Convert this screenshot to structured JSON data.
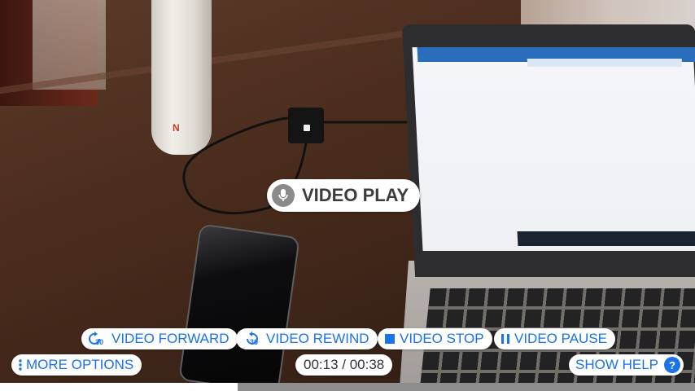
{
  "overlay": {
    "play_label": "VIDEO PLAY",
    "forward_label": "VIDEO FORWARD",
    "rewind_label": "VIDEO REWIND",
    "stop_label": "VIDEO STOP",
    "pause_label": "VIDEO PAUSE",
    "more_label": "MORE OPTIONS",
    "time_label": "00:13 / 00:38",
    "help_label": "SHOW HELP",
    "help_glyph": "?",
    "skip_seconds": "30"
  },
  "playback": {
    "current_seconds": 13,
    "total_seconds": 38,
    "progress_fraction": 0.342
  },
  "icons": {
    "play": "mic-icon",
    "forward": "forward-30-icon",
    "rewind": "rewind-30-icon",
    "stop": "stop-icon",
    "pause": "pause-icon",
    "more": "more-vertical-icon",
    "help": "help-icon"
  },
  "colors": {
    "accent": "#1a73e8",
    "pill_bg": "#ffffff",
    "mic_bg": "#8a8a8a",
    "progress_fill": "#ffffff",
    "progress_track": "#8d8d8d"
  }
}
